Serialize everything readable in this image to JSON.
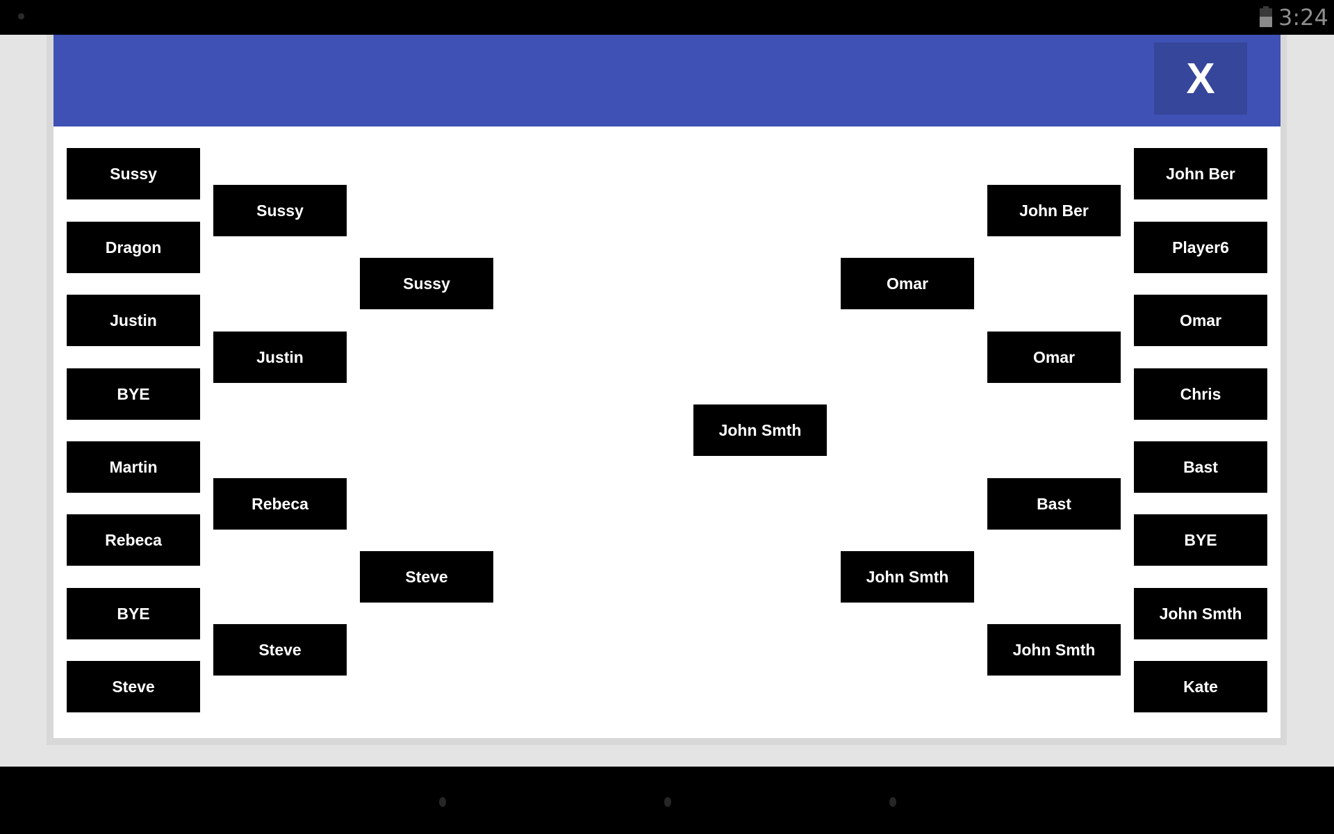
{
  "status_bar": {
    "time": "3:24",
    "battery_level": 0.55,
    "notification_icon": "dot-icon",
    "battery_icon": "battery-icon"
  },
  "dialog": {
    "header_color": "#3f51b5",
    "close_button": {
      "label": "X",
      "color": "#35469b"
    }
  },
  "bracket": {
    "left": {
      "round1": [
        "Sussy",
        "Dragon",
        "Justin",
        "BYE",
        "Martin",
        "Rebeca",
        "BYE",
        "Steve"
      ],
      "round2": [
        "Sussy",
        "Justin",
        "Rebeca",
        "Steve"
      ],
      "round3": [
        "Sussy",
        "Steve"
      ]
    },
    "right": {
      "round1": [
        "John Ber",
        "Player6",
        "Omar",
        "Chris",
        "Bast",
        "BYE",
        "John Smth",
        "Kate"
      ],
      "round2": [
        "John Ber",
        "Omar",
        "Bast",
        "John Smth"
      ],
      "round3": [
        "Omar",
        "John Smth"
      ]
    },
    "final": "John Smth"
  },
  "nav_bar": {
    "buttons": [
      "back-button",
      "home-button",
      "recents-button"
    ]
  }
}
